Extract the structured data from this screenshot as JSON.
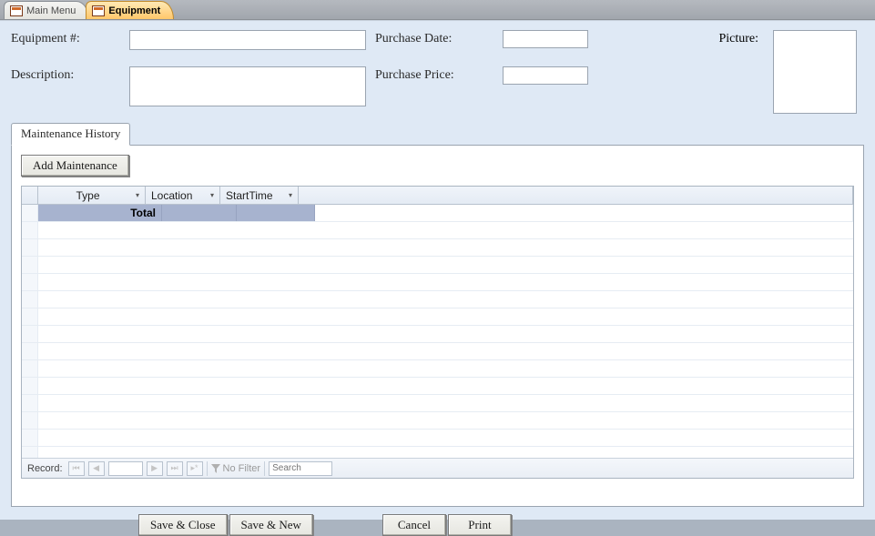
{
  "tabs": {
    "main_menu": "Main Menu",
    "equipment": "Equipment"
  },
  "form": {
    "equipment_no_label": "Equipment #:",
    "equipment_no_value": "",
    "description_label": "Description:",
    "description_value": "",
    "purchase_date_label": "Purchase Date:",
    "purchase_date_value": "",
    "purchase_price_label": "Purchase Price:",
    "purchase_price_value": "",
    "picture_label": "Picture:"
  },
  "subform": {
    "tab_label": "Maintenance History",
    "add_button": "Add Maintenance",
    "columns": {
      "type": "Type",
      "location": "Location",
      "start_time": "StartTime"
    },
    "total_label": "Total"
  },
  "recordnav": {
    "label": "Record:",
    "current": "",
    "filter_label": "No Filter",
    "search_placeholder": "Search"
  },
  "actions": {
    "save_close": "Save & Close",
    "save_new": "Save & New",
    "cancel": "Cancel",
    "print": "Print"
  }
}
